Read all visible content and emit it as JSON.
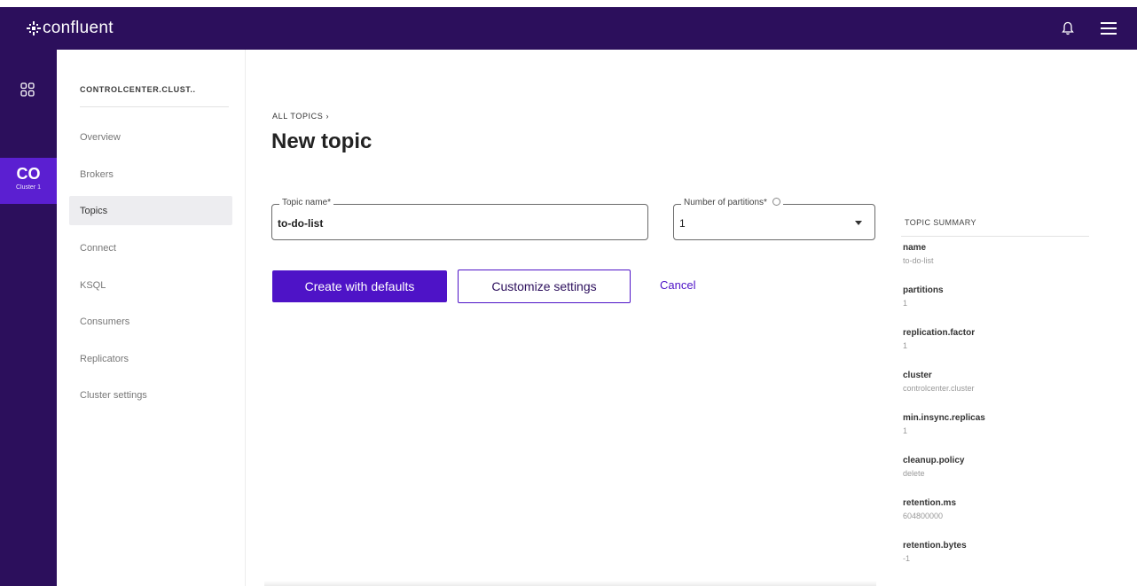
{
  "brand": {
    "name": "confluent"
  },
  "header": {
    "bell_icon": "bell-icon",
    "menu_icon": "hamburger-menu-icon"
  },
  "rail": {
    "grid_icon": "grid-icon",
    "cluster_abbr": "CO",
    "cluster_sub": "Cluster 1"
  },
  "sidebar": {
    "cluster_name": "CONTROLCENTER.CLUST..",
    "items": [
      {
        "label": "Overview"
      },
      {
        "label": "Brokers"
      },
      {
        "label": "Topics",
        "active": true
      },
      {
        "label": "Connect"
      },
      {
        "label": "KSQL"
      },
      {
        "label": "Consumers"
      },
      {
        "label": "Replicators"
      },
      {
        "label": "Cluster settings"
      }
    ]
  },
  "main": {
    "breadcrumb": "ALL TOPICS ›",
    "title": "New topic",
    "topic_name_field": {
      "label": "Topic name*",
      "value": "to-do-list"
    },
    "partitions_field": {
      "label": "Number of partitions*",
      "value": "1"
    },
    "buttons": {
      "create": "Create with defaults",
      "customize": "Customize settings",
      "cancel": "Cancel"
    }
  },
  "summary": {
    "title": "TOPIC SUMMARY",
    "rows": [
      {
        "key": "name",
        "value": "to-do-list"
      },
      {
        "key": "partitions",
        "value": "1"
      },
      {
        "key": "replication.factor",
        "value": "1"
      },
      {
        "key": "cluster",
        "value": "controlcenter.cluster"
      },
      {
        "key": "min.insync.replicas",
        "value": "1"
      },
      {
        "key": "cleanup.policy",
        "value": "delete"
      },
      {
        "key": "retention.ms",
        "value": "604800000"
      },
      {
        "key": "retention.bytes",
        "value": "-1"
      }
    ]
  },
  "colors": {
    "header_bg": "#2c0f5c",
    "accent": "#4e13c7",
    "rail_active": "#5b1fd1"
  }
}
